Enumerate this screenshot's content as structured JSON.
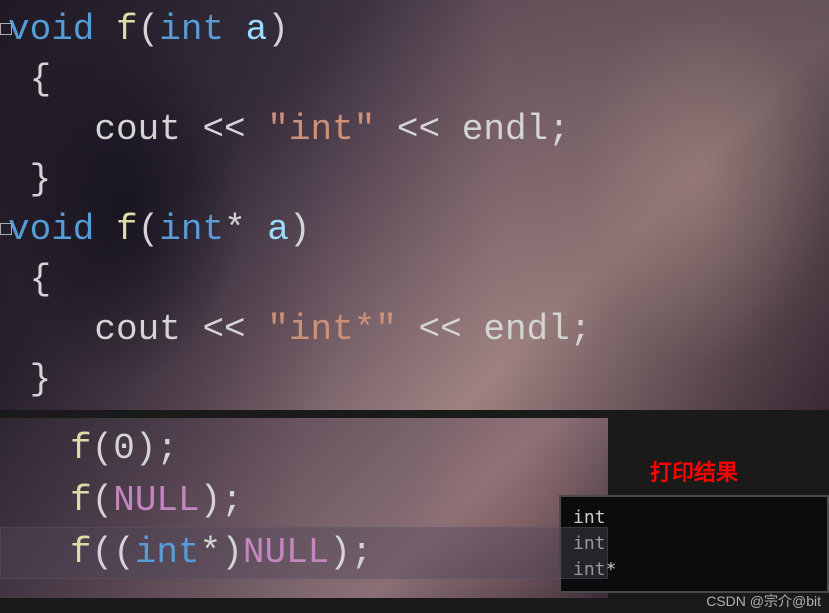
{
  "code1": {
    "line1": {
      "kw_void": "void",
      "fn": "f",
      "paren_open": "(",
      "kw_int": "int",
      "param": "a",
      "paren_close": ")"
    },
    "line2": {
      "brace": "{"
    },
    "line3": {
      "indent": "    ",
      "cout": "cout",
      "op1": "<<",
      "str": "\"int\"",
      "op2": "<<",
      "endl": "endl",
      "semi": ";"
    },
    "line4": {
      "brace": "}"
    },
    "line5": {
      "kw_void": "void",
      "fn": "f",
      "paren_open": "(",
      "kw_int": "int",
      "star": "*",
      "param": "a",
      "paren_close": ")"
    },
    "line6": {
      "brace": "{"
    },
    "line7": {
      "indent": "    ",
      "cout": "cout",
      "op1": "<<",
      "str": "\"int*\"",
      "op2": "<<",
      "endl": "endl",
      "semi": ";"
    },
    "line8": {
      "brace": "}"
    }
  },
  "code2": {
    "line1": {
      "fn": "f",
      "paren_open": "(",
      "arg": "0",
      "paren_close": ")",
      "semi": ";"
    },
    "line2": {
      "fn": "f",
      "paren_open": "(",
      "arg": "NULL",
      "paren_close": ")",
      "semi": ";"
    },
    "line3": {
      "fn": "f",
      "paren_open": "(",
      "cast_open": "(",
      "kw_int": "int",
      "star": "*",
      "cast_close": ")",
      "arg": "NULL",
      "paren_close": ")",
      "semi": ";"
    }
  },
  "result": {
    "label": "打印结果",
    "lines": [
      "int",
      "int",
      "int*"
    ]
  },
  "watermark": "CSDN @宗介@bit"
}
